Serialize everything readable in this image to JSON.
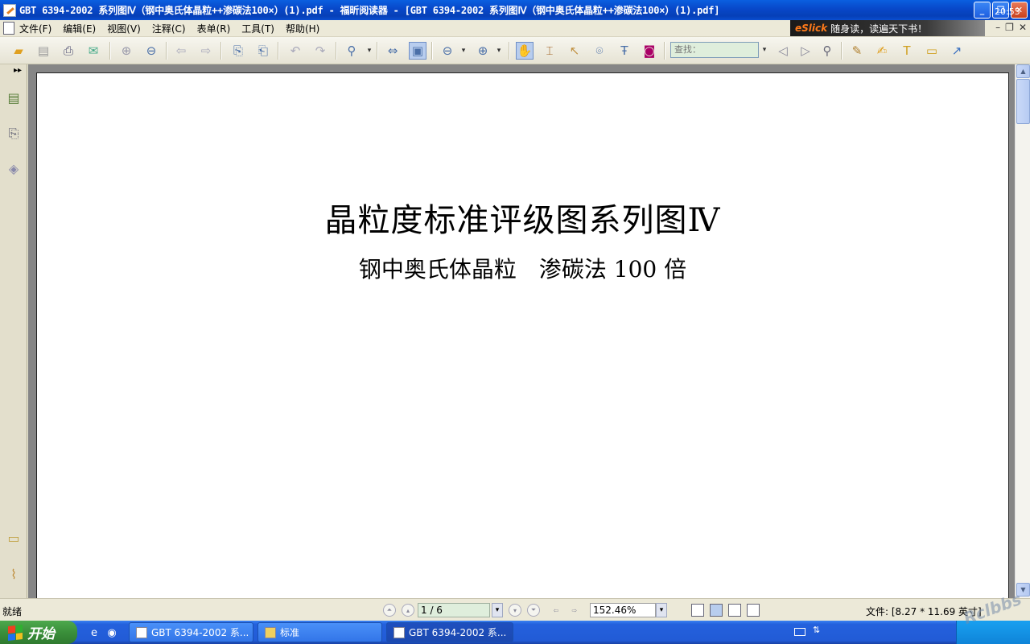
{
  "window": {
    "title": "GBT 6394-2002 系列图Ⅳ（钢中奥氏体晶粒++渗碳法100×）(1).pdf - 福昕阅读器 - [GBT 6394-2002 系列图Ⅳ（钢中奥氏体晶粒++渗碳法100×）(1).pdf]",
    "minimize": "_",
    "maximize": "❐",
    "close": "✕"
  },
  "menu": {
    "items": [
      "文件(F)",
      "编辑(E)",
      "视图(V)",
      "注释(C)",
      "表单(R)",
      "工具(T)",
      "帮助(H)"
    ],
    "banner_brand": "eSlick",
    "banner_text": "随身读，读遍天下书！",
    "mdi_buttons": [
      "–",
      "❐",
      "✕"
    ]
  },
  "toolbar": {
    "search_placeholder": "查找："
  },
  "document": {
    "title": "晶粒度标准评级图系列图Ⅳ",
    "subtitle": "钢中奥氏体晶粒　渗碳法 100 倍"
  },
  "status": {
    "text": "就绪",
    "page": "1 / 6",
    "zoom": "152.46%",
    "file_size": "文件: [8.27 * 11.69 英寸]"
  },
  "taskbar": {
    "start": "开始",
    "tasks": [
      "GBT 6394-2002 系...",
      "标准",
      "GBT 6394-2002 系..."
    ],
    "clock": "20:55"
  },
  "watermark": "Rclbbs"
}
